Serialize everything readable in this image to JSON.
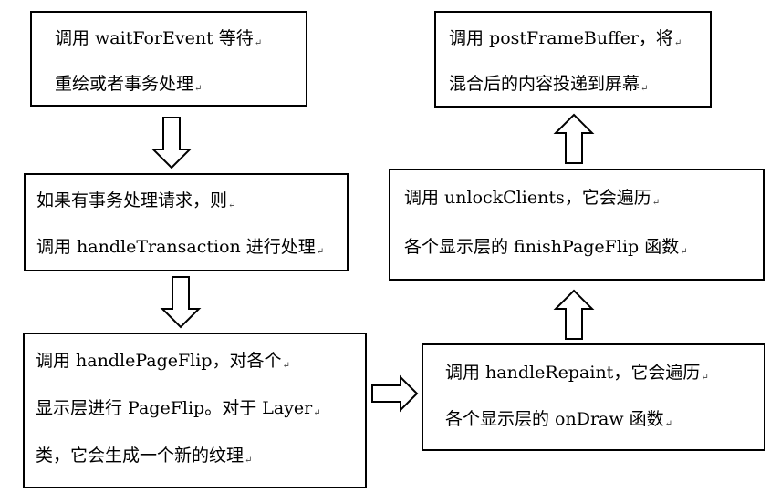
{
  "boxes": [
    {
      "id": "box1",
      "lines": [
        "调用 waitForEvent 等待",
        "重绘或者事务处理"
      ]
    },
    {
      "id": "box2",
      "lines": [
        "如果有事务处理请求，则",
        "调用 handleTransaction 进行处理"
      ]
    },
    {
      "id": "box3",
      "lines": [
        "调用 handlePageFlip，对各个",
        "显示层进行 PageFlip。对于 Layer",
        "类，它会生成一个新的纹理"
      ]
    },
    {
      "id": "box4",
      "lines": [
        "调用 handleRepaint，它会遍历",
        "各个显示层的 onDraw 函数"
      ]
    },
    {
      "id": "box5",
      "lines": [
        "调用 unlockClients，它会遍历",
        "各个显示层的 finishPageFlip 函数"
      ]
    },
    {
      "id": "box6",
      "lines": [
        "调用 postFrameBuffer，将",
        "混合后的内容投递到屏幕"
      ]
    }
  ],
  "paragraph_mark": "↵"
}
